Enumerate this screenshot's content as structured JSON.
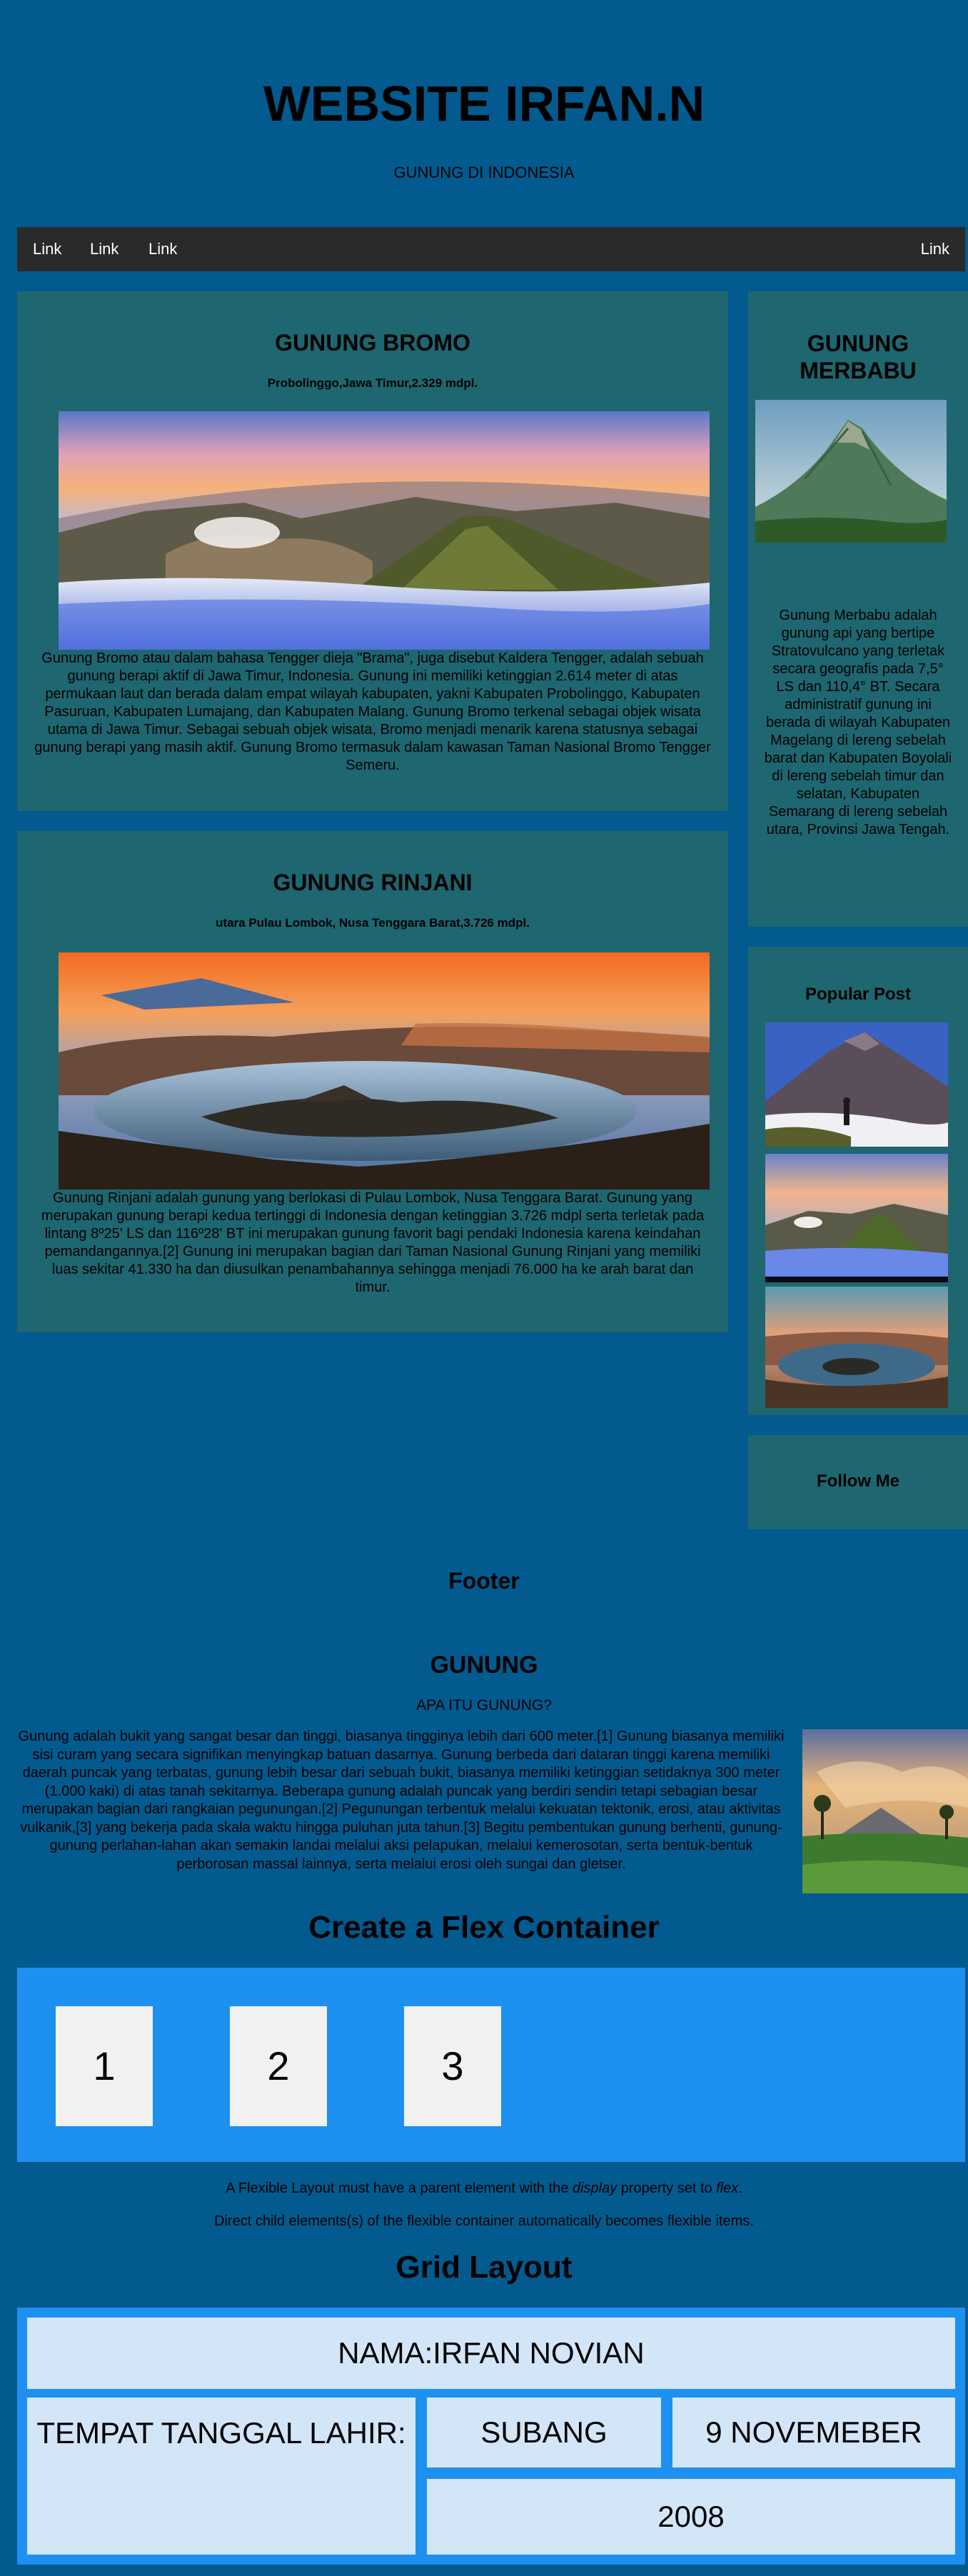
{
  "header": {
    "title": "WEBSITE IRFAN.N",
    "subtitle": "GUNUNG DI INDONESIA"
  },
  "nav": {
    "links": [
      "Link",
      "Link",
      "Link"
    ],
    "right_link": "Link"
  },
  "bromo": {
    "title": "GUNUNG BROMO",
    "meta": "Probolinggo,Jawa Timur,2.329 mdpl.",
    "description": "Gunung Bromo atau dalam bahasa Tengger dieja \"Brama\", juga disebut Kaldera Tengger, adalah sebuah gunung berapi aktif di Jawa Timur, Indonesia. Gunung ini memiliki ketinggian 2.614 meter di atas permukaan laut dan berada dalam empat wilayah kabupaten, yakni Kabupaten Probolinggo, Kabupaten Pasuruan, Kabupaten Lumajang, dan Kabupaten Malang. Gunung Bromo terkenal sebagai objek wisata utama di Jawa Timur. Sebagai sebuah objek wisata, Bromo menjadi menarik karena statusnya sebagai gunung berapi yang masih aktif. Gunung Bromo termasuk dalam kawasan Taman Nasional Bromo Tengger Semeru."
  },
  "rinjani": {
    "title": "GUNUNG RINJANI",
    "meta": "utara Pulau Lombok, Nusa Tenggara Barat,3.726 mdpl.",
    "description": "Gunung Rinjani adalah gunung yang berlokasi di Pulau Lombok, Nusa Tenggara Barat. Gunung yang merupakan gunung berapi kedua tertinggi di Indonesia dengan ketinggian 3.726 mdpl serta terletak pada lintang 8º25' LS dan 116º28' BT ini merupakan gunung favorit bagi pendaki Indonesia karena keindahan pemandangannya.[2] Gunung ini merupakan bagian dari Taman Nasional Gunung Rinjani yang memiliki luas sekitar 41.330 ha dan diusulkan penambahannya sehingga menjadi 76.000 ha ke arah barat dan timur."
  },
  "merbabu": {
    "title_line1": "GUNUNG",
    "title_line2": "MERBABU",
    "description": "Gunung Merbabu adalah gunung api yang bertipe Stratovulcano yang terletak secara geografis pada 7,5° LS dan 110,4° BT. Secara administratif gunung ini berada di wilayah Kabupaten Magelang di lereng sebelah barat dan Kabupaten Boyolali di lereng sebelah timur dan selatan, Kabupaten Semarang di lereng sebelah utara, Provinsi Jawa Tengah."
  },
  "popular": {
    "title": "Popular Post"
  },
  "follow": {
    "title": "Follow Me"
  },
  "footer": {
    "title": "Footer"
  },
  "gunung": {
    "title": "GUNUNG",
    "subtitle": "APA ITU GUNUNG?",
    "text": "Gunung adalah bukit yang sangat besar dan tinggi, biasanya tingginya lebih dari 600 meter.[1] Gunung biasanya memiliki sisi curam yang secara signifikan menyingkap batuan dasarnya. Gunung berbeda dari dataran tinggi karena memiliki daerah puncak yang terbatas, gunung lebih besar dari sebuah bukit, biasanya memiliki ketinggian setidaknya 300 meter (1.000 kaki) di atas tanah sekitarnya. Beberapa gunung adalah puncak yang berdiri sendiri tetapi sebagian besar merupakan bagian dari rangkaian pegunungan.[2] Pegunungan terbentuk melalui kekuatan tektonik, erosi, atau aktivitas vulkanik,[3] yang bekerja pada skala waktu hingga puluhan juta tahun.[3] Begitu pembentukan gunung berhenti, gunung-gunung perlahan-lahan akan semakin landai melalui aksi pelapukan, melalui kemerosotan, serta bentuk-bentuk perborosan massal lainnya, serta melalui erosi oleh sungai dan gletser."
  },
  "flex": {
    "title": "Create a Flex Container",
    "items": [
      "1",
      "2",
      "3"
    ],
    "note1_before": "A Flexible Layout must have a parent element with the ",
    "note1_em1": "display",
    "note1_middle": " property set to ",
    "note1_em2": "flex",
    "note1_after": ".",
    "note2": "Direct child elements(s) of the flexible container automatically becomes flexible items."
  },
  "grid": {
    "title": "Grid Layout",
    "name": "NAMA:IRFAN NOVIAN",
    "birth_label": "TEMPAT TANGGAL LAHIR:",
    "place": "SUBANG",
    "date": "9 NOVEMEBER",
    "year": "2008"
  },
  "colors": {
    "page_bg": "#025A8E",
    "card_bg": "#1E6670",
    "navbar_bg": "#2A2A2A",
    "container_blue": "#1E90F0",
    "grid_cell": "#D2E6F8",
    "flex_item": "#F1F1F1"
  }
}
